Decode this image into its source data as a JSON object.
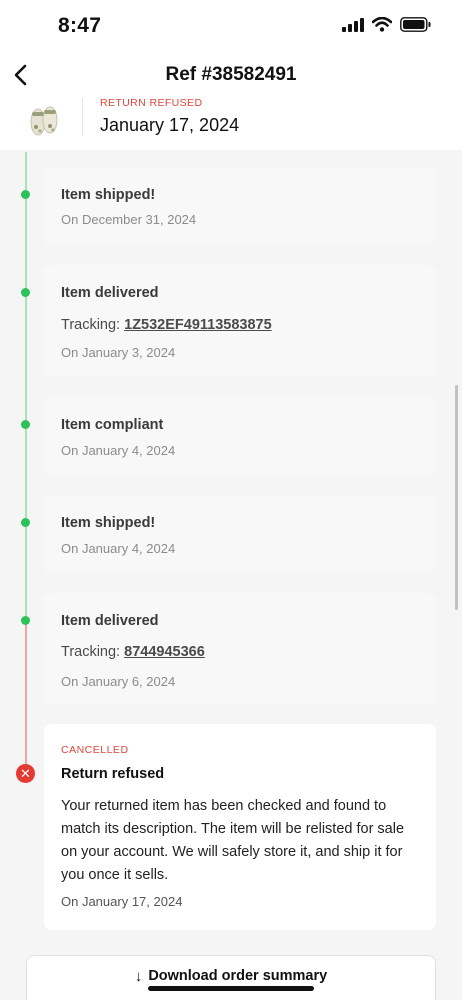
{
  "status_bar": {
    "time": "8:47"
  },
  "header": {
    "title": "Ref #38582491",
    "order_status": "RETURN REFUSED",
    "order_date": "January 17, 2024"
  },
  "timeline": [
    {
      "title": "Item shipped!",
      "tracking_label": "",
      "tracking_number": "",
      "date": "On December 31, 2024"
    },
    {
      "title": "Item delivered",
      "tracking_label": "Tracking: ",
      "tracking_number": "1Z532EF49113583875",
      "date": "On January 3, 2024"
    },
    {
      "title": "Item compliant",
      "tracking_label": "",
      "tracking_number": "",
      "date": "On January 4, 2024"
    },
    {
      "title": "Item shipped!",
      "tracking_label": "",
      "tracking_number": "",
      "date": "On January 4, 2024"
    },
    {
      "title": "Item delivered",
      "tracking_label": "Tracking: ",
      "tracking_number": "8744945366",
      "date": "On January 6, 2024"
    }
  ],
  "refused": {
    "label": "CANCELLED",
    "title": "Return refused",
    "description": "Your returned item has been checked and found to match its description. The item will be relisted for sale on your account. We will safely store it, and ship it for you once it sells.",
    "date": "On January 17, 2024"
  },
  "download": {
    "label": "Download order summary"
  },
  "colors": {
    "accent_red": "#e0453a",
    "timeline_green": "#2bc25a",
    "cancel_red": "#e53a34"
  }
}
